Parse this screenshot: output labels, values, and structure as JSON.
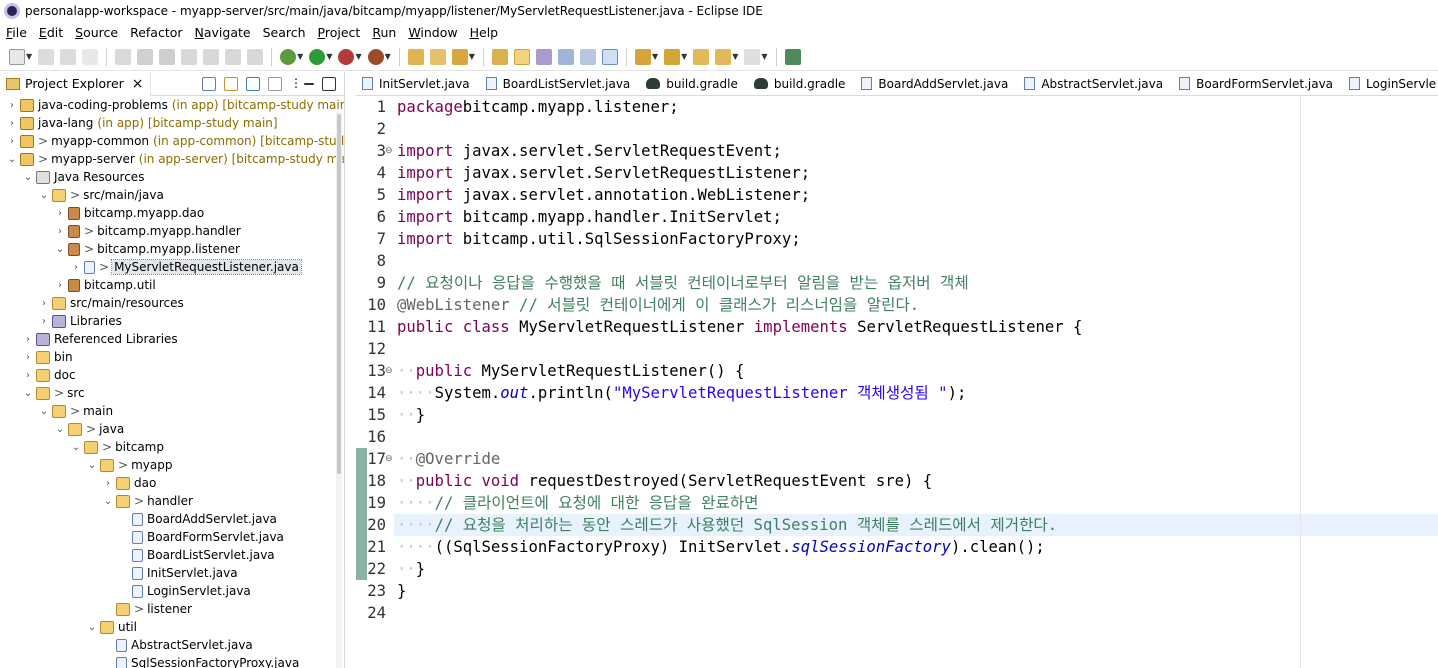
{
  "window": {
    "title": "personalapp-workspace - myapp-server/src/main/java/bitcamp/myapp/listener/MyServletRequestListener.java - Eclipse IDE"
  },
  "menu": [
    {
      "label": "File",
      "u": "F",
      "rest": "ile"
    },
    {
      "label": "Edit",
      "u": "E",
      "rest": "dit"
    },
    {
      "label": "Source",
      "u": "S",
      "rest": "ource"
    },
    {
      "label": "Refactor",
      "u": "",
      "rest": "Refactor"
    },
    {
      "label": "Navigate",
      "u": "N",
      "rest": "avigate"
    },
    {
      "label": "Search",
      "u": "",
      "rest": "Search"
    },
    {
      "label": "Project",
      "u": "P",
      "rest": "roject"
    },
    {
      "label": "Run",
      "u": "R",
      "rest": "un"
    },
    {
      "label": "Window",
      "u": "W",
      "rest": "indow"
    },
    {
      "label": "Help",
      "u": "H",
      "rest": "elp"
    }
  ],
  "explorer": {
    "title": "Project Explorer",
    "close": "×",
    "tree": [
      {
        "depth": 0,
        "tw": "›",
        "icon": "proj",
        "gt": "",
        "name": "java-coding-problems",
        "muted": "(in app) [bitcamp-study main]"
      },
      {
        "depth": 0,
        "tw": "›",
        "icon": "proj",
        "gt": "",
        "name": "java-lang",
        "muted": "(in app) [bitcamp-study main]"
      },
      {
        "depth": 0,
        "tw": "›",
        "icon": "proj",
        "gt": ">",
        "name": "myapp-common",
        "muted": "(in app-common) [bitcamp-study"
      },
      {
        "depth": 0,
        "tw": "⌄",
        "icon": "proj",
        "gt": ">",
        "name": "myapp-server",
        "muted": "(in app-server) [bitcamp-study main]"
      },
      {
        "depth": 1,
        "tw": "⌄",
        "icon": "jres",
        "gt": "",
        "name": "Java Resources",
        "muted": ""
      },
      {
        "depth": 2,
        "tw": "⌄",
        "icon": "srcf",
        "gt": ">",
        "name": "src/main/java",
        "muted": ""
      },
      {
        "depth": 3,
        "tw": "›",
        "icon": "pkg",
        "gt": "",
        "name": "bitcamp.myapp.dao",
        "muted": ""
      },
      {
        "depth": 3,
        "tw": "›",
        "icon": "pkg",
        "gt": ">",
        "name": "bitcamp.myapp.handler",
        "muted": ""
      },
      {
        "depth": 3,
        "tw": "⌄",
        "icon": "pkg",
        "gt": ">",
        "name": "bitcamp.myapp.listener",
        "muted": ""
      },
      {
        "depth": 4,
        "tw": "›",
        "icon": "jfile",
        "gt": ">",
        "name": "MyServletRequestListener.java",
        "muted": "",
        "selected": true
      },
      {
        "depth": 3,
        "tw": "›",
        "icon": "pkg",
        "gt": "",
        "name": "bitcamp.util",
        "muted": ""
      },
      {
        "depth": 2,
        "tw": "›",
        "icon": "srcf",
        "gt": "",
        "name": "src/main/resources",
        "muted": ""
      },
      {
        "depth": 2,
        "tw": "›",
        "icon": "lib",
        "gt": "",
        "name": "Libraries",
        "muted": ""
      },
      {
        "depth": 1,
        "tw": "›",
        "icon": "lib",
        "gt": "",
        "name": "Referenced Libraries",
        "muted": ""
      },
      {
        "depth": 1,
        "tw": "›",
        "icon": "folder",
        "gt": "",
        "name": "bin",
        "muted": ""
      },
      {
        "depth": 1,
        "tw": "›",
        "icon": "folder",
        "gt": "",
        "name": "doc",
        "muted": ""
      },
      {
        "depth": 1,
        "tw": "⌄",
        "icon": "folder",
        "gt": ">",
        "name": "src",
        "muted": ""
      },
      {
        "depth": 2,
        "tw": "⌄",
        "icon": "folder",
        "gt": ">",
        "name": "main",
        "muted": ""
      },
      {
        "depth": 3,
        "tw": "⌄",
        "icon": "folder",
        "gt": ">",
        "name": "java",
        "muted": ""
      },
      {
        "depth": 4,
        "tw": "⌄",
        "icon": "folder",
        "gt": ">",
        "name": "bitcamp",
        "muted": ""
      },
      {
        "depth": 5,
        "tw": "⌄",
        "icon": "folder",
        "gt": ">",
        "name": "myapp",
        "muted": ""
      },
      {
        "depth": 6,
        "tw": "›",
        "icon": "folder",
        "gt": "",
        "name": "dao",
        "muted": ""
      },
      {
        "depth": 6,
        "tw": "⌄",
        "icon": "folder",
        "gt": ">",
        "name": "handler",
        "muted": ""
      },
      {
        "depth": 7,
        "tw": "",
        "icon": "jfile",
        "gt": "",
        "name": "BoardAddServlet.java",
        "muted": ""
      },
      {
        "depth": 7,
        "tw": "",
        "icon": "jfile",
        "gt": "",
        "name": "BoardFormServlet.java",
        "muted": ""
      },
      {
        "depth": 7,
        "tw": "",
        "icon": "jfile",
        "gt": "",
        "name": "BoardListServlet.java",
        "muted": ""
      },
      {
        "depth": 7,
        "tw": "",
        "icon": "jfile",
        "gt": "",
        "name": "InitServlet.java",
        "muted": ""
      },
      {
        "depth": 7,
        "tw": "",
        "icon": "jfile",
        "gt": "",
        "name": "LoginServlet.java",
        "muted": ""
      },
      {
        "depth": 6,
        "tw": "",
        "icon": "folder",
        "gt": ">",
        "name": "listener",
        "muted": ""
      },
      {
        "depth": 5,
        "tw": "⌄",
        "icon": "folder",
        "gt": "",
        "name": "util",
        "muted": ""
      },
      {
        "depth": 6,
        "tw": "",
        "icon": "jfile",
        "gt": "",
        "name": "AbstractServlet.java",
        "muted": ""
      },
      {
        "depth": 6,
        "tw": "",
        "icon": "jfile",
        "gt": "",
        "name": "SqlSessionFactoryProxy.java",
        "muted": ""
      }
    ]
  },
  "editor_tabs": [
    {
      "label": "InitServlet.java",
      "icon": "java"
    },
    {
      "label": "BoardListServlet.java",
      "icon": "java"
    },
    {
      "label": "build.gradle",
      "icon": "gradle"
    },
    {
      "label": "build.gradle",
      "icon": "gradle"
    },
    {
      "label": "BoardAddServlet.java",
      "icon": "java"
    },
    {
      "label": "AbstractServlet.java",
      "icon": "java"
    },
    {
      "label": "BoardFormServlet.java",
      "icon": "java"
    },
    {
      "label": "LoginServle",
      "icon": "java"
    }
  ],
  "code": {
    "highlight_line": 20,
    "lines": [
      {
        "n": "1",
        "fold": "",
        "segs": [
          [
            "kw",
            "package"
          ],
          [
            "",
            "bitcamp.myapp.listener;"
          ]
        ]
      },
      {
        "n": "2",
        "fold": "",
        "segs": []
      },
      {
        "n": "3",
        "fold": "⊖",
        "segs": [
          [
            "kw",
            "import"
          ],
          [
            "",
            " javax.servlet.ServletRequestEvent;"
          ]
        ]
      },
      {
        "n": "4",
        "fold": "",
        "segs": [
          [
            "kw",
            "import"
          ],
          [
            "",
            " javax.servlet.ServletRequestListener;"
          ]
        ]
      },
      {
        "n": "5",
        "fold": "",
        "segs": [
          [
            "kw",
            "import"
          ],
          [
            "",
            " javax.servlet.annotation.WebListener;"
          ]
        ]
      },
      {
        "n": "6",
        "fold": "",
        "segs": [
          [
            "kw",
            "import"
          ],
          [
            "",
            " bitcamp.myapp.handler.InitServlet;"
          ]
        ]
      },
      {
        "n": "7",
        "fold": "",
        "segs": [
          [
            "kw",
            "import"
          ],
          [
            "",
            " bitcamp.util.SqlSessionFactoryProxy;"
          ]
        ]
      },
      {
        "n": "8",
        "fold": "",
        "segs": []
      },
      {
        "n": "9",
        "fold": "",
        "segs": [
          [
            "cm",
            "// 요청이나 응답을 수행했을 때 서블릿 컨테이너로부터 알림을 받는 옵저버 객체"
          ]
        ]
      },
      {
        "n": "10",
        "fold": "",
        "segs": [
          [
            "an",
            "@WebListener"
          ],
          [
            "cm",
            " // 서블릿 컨테이너에게 이 클래스가 리스너임을 알린다."
          ]
        ]
      },
      {
        "n": "11",
        "fold": "",
        "segs": [
          [
            "kw",
            "public"
          ],
          [
            "",
            " "
          ],
          [
            "kw",
            "class"
          ],
          [
            "",
            " MyServletRequestListener "
          ],
          [
            "kw",
            "implements"
          ],
          [
            "",
            " ServletRequestListener {"
          ]
        ]
      },
      {
        "n": "12",
        "fold": "",
        "segs": []
      },
      {
        "n": "13",
        "fold": "⊖",
        "segs": [
          [
            "ws",
            "··"
          ],
          [
            "kw",
            "public"
          ],
          [
            "",
            " MyServletRequestListener() {"
          ]
        ]
      },
      {
        "n": "14",
        "fold": "",
        "segs": [
          [
            "ws",
            "····"
          ],
          [
            "",
            "System."
          ],
          [
            "it",
            "out"
          ],
          [
            "",
            ".println("
          ],
          [
            "st",
            "\"MyServletRequestListener 객체생성됨 \""
          ],
          [
            "",
            ");"
          ]
        ]
      },
      {
        "n": "15",
        "fold": "",
        "segs": [
          [
            "ws",
            "··"
          ],
          [
            "",
            "}"
          ]
        ]
      },
      {
        "n": "16",
        "fold": "",
        "segs": []
      },
      {
        "n": "17",
        "fold": "⊖",
        "segs": [
          [
            "ws",
            "··"
          ],
          [
            "an",
            "@Override"
          ]
        ]
      },
      {
        "n": "18",
        "fold": "",
        "segs": [
          [
            "ws",
            "··"
          ],
          [
            "kw",
            "public"
          ],
          [
            "",
            " "
          ],
          [
            "kw",
            "void"
          ],
          [
            "",
            " requestDestroyed(ServletRequestEvent sre) {"
          ]
        ]
      },
      {
        "n": "19",
        "fold": "",
        "segs": [
          [
            "ws",
            "····"
          ],
          [
            "cm",
            "// 클라이언트에 요청에 대한 응답을 완료하면"
          ]
        ]
      },
      {
        "n": "20",
        "fold": "",
        "segs": [
          [
            "ws",
            "····"
          ],
          [
            "cm",
            "// 요청을 처리하는 동안 스레드가 사용했던 SqlSession 객체를 스레드에서 제거한다."
          ]
        ]
      },
      {
        "n": "21",
        "fold": "",
        "segs": [
          [
            "ws",
            "····"
          ],
          [
            "",
            "((SqlSessionFactoryProxy) InitServlet."
          ],
          [
            "it",
            "sqlSessionFactory"
          ],
          [
            "",
            ").clean();"
          ]
        ]
      },
      {
        "n": "22",
        "fold": "",
        "segs": [
          [
            "ws",
            "··"
          ],
          [
            "",
            "}"
          ]
        ]
      },
      {
        "n": "23",
        "fold": "",
        "segs": [
          [
            "",
            "}"
          ]
        ]
      },
      {
        "n": "24",
        "fold": "",
        "segs": []
      }
    ]
  }
}
